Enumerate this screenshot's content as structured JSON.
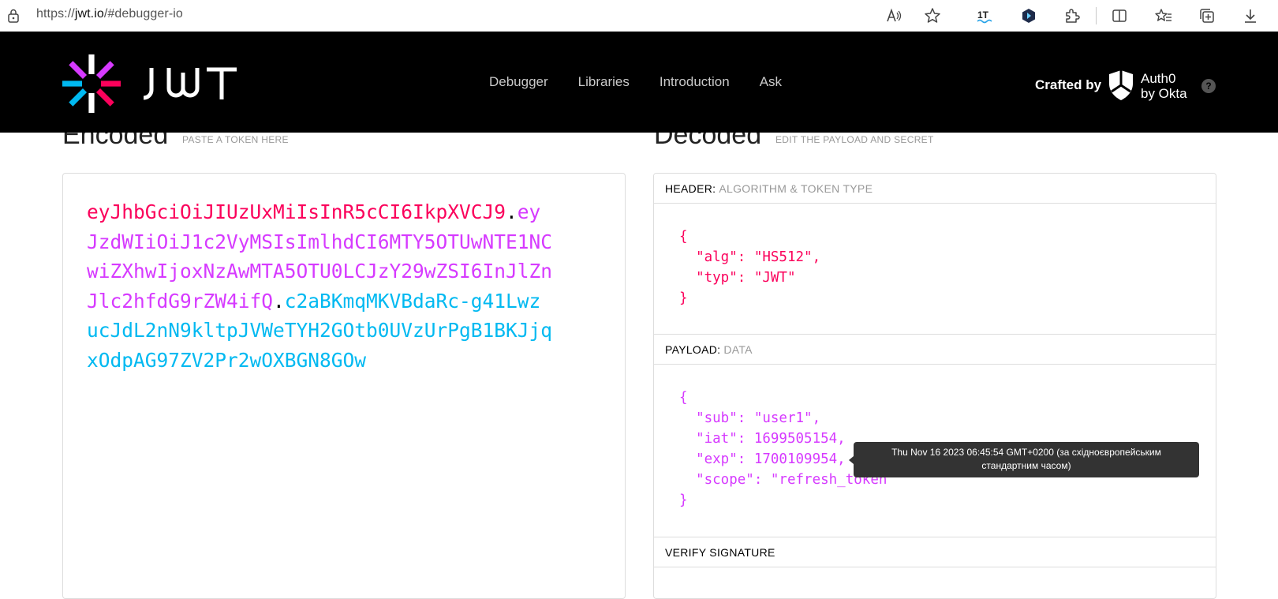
{
  "browser": {
    "url_prefix": "https://",
    "url_host": "jwt.io",
    "url_path": "/#debugger-io"
  },
  "header": {
    "nav": [
      "Debugger",
      "Libraries",
      "Introduction",
      "Ask"
    ],
    "crafted_by": "Crafted by",
    "auth0_line1": "Auth0",
    "auth0_line2": "by Okta",
    "help": "?"
  },
  "encoded": {
    "title": "Encoded",
    "subtitle": "PASTE A TOKEN HERE",
    "token_header": "eyJhbGciOiJIUzUxMiIsInR5cCI6IkpXVCJ9",
    "token_payload": "eyJzdWIiOiJ1c2VyMSIsImlhdCI6MTY5OTUwNTE1NCwiZXhwIjoxNzAwMTA5OTU0LCJzY29wZSI6InJlZnJlc2hfdG9rZW4ifQ",
    "token_signature": "c2aBKmqMKVBdaRc-g41LwzucJdL2nN9kltpJVWeTYH2GOtb0UVzUrPgB1BKJjqxOdpAG97ZV2Pr2wOXBGN8GOw",
    "dot": "."
  },
  "decoded": {
    "title": "Decoded",
    "subtitle": "EDIT THE PAYLOAD AND SECRET",
    "header_label": "HEADER:",
    "header_sub": "ALGORITHM & TOKEN TYPE",
    "header_json": "{\n  \"alg\": \"HS512\",\n  \"typ\": \"JWT\"\n}",
    "payload_label": "PAYLOAD:",
    "payload_sub": "DATA",
    "payload_json": "{\n  \"sub\": \"user1\",\n  \"iat\": 1699505154,\n  \"exp\": 1700109954,\n  \"scope\": \"refresh_token\"\n}",
    "verify_label": "VERIFY SIGNATURE"
  },
  "tooltip": {
    "line1": "Thu Nov 16 2023 06:45:54 GMT+0200 (за східноєвропейським",
    "line2": "стандартним часом)"
  },
  "icons": [
    "lock-icon",
    "read-aloud-icon",
    "favorite-star-icon",
    "lt-extension-icon",
    "extension-hex-icon",
    "extensions-puzzle-icon",
    "split-screen-icon",
    "favorites-icon",
    "collections-icon",
    "download-icon"
  ]
}
